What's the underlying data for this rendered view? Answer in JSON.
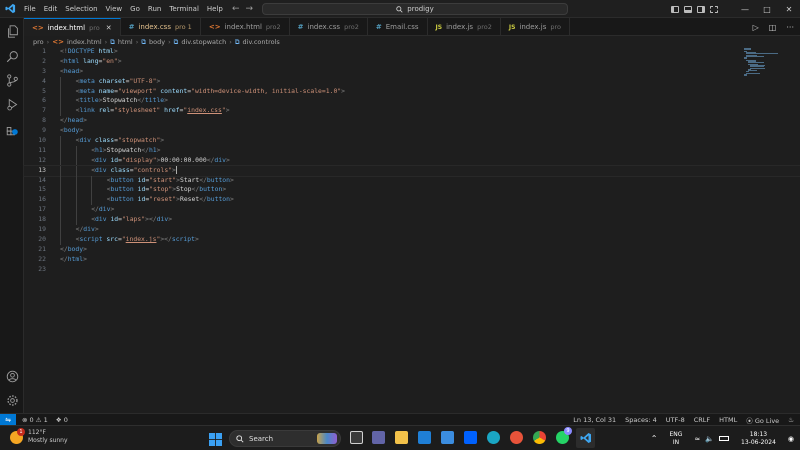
{
  "titlebar": {
    "menu": [
      "File",
      "Edit",
      "Selection",
      "View",
      "Go",
      "Run",
      "Terminal",
      "Help"
    ],
    "search_text": "prodigy"
  },
  "tabs": [
    {
      "icon": "html",
      "icon_text": "<>",
      "name": "index.html",
      "hint": "pro",
      "active": true,
      "modified": false
    },
    {
      "icon": "css",
      "icon_text": "#",
      "name": "index.css",
      "hint": "pro 1",
      "active": false,
      "modified": true
    },
    {
      "icon": "html",
      "icon_text": "<>",
      "name": "index.html",
      "hint": "pro2",
      "active": false,
      "modified": false
    },
    {
      "icon": "css",
      "icon_text": "#",
      "name": "index.css",
      "hint": "pro2",
      "active": false,
      "modified": false
    },
    {
      "icon": "css",
      "icon_text": "#",
      "name": "Email.css",
      "hint": "",
      "active": false,
      "modified": false
    },
    {
      "icon": "js",
      "icon_text": "JS",
      "name": "index.js",
      "hint": "pro2",
      "active": false,
      "modified": false
    },
    {
      "icon": "js",
      "icon_text": "JS",
      "name": "index.js",
      "hint": "pro",
      "active": false,
      "modified": false
    }
  ],
  "breadcrumb": [
    "pro",
    "index.html",
    "html",
    "body",
    "div.stopwatch",
    "div.controls"
  ],
  "code_lines": [
    {
      "n": "1",
      "indent": 0,
      "tokens": [
        [
          "br",
          "<!"
        ],
        [
          "tag",
          "DOCTYPE"
        ],
        [
          "text",
          " "
        ],
        [
          "attr",
          "html"
        ],
        [
          "br",
          ">"
        ]
      ]
    },
    {
      "n": "2",
      "indent": 0,
      "tokens": [
        [
          "br",
          "<"
        ],
        [
          "tag",
          "html"
        ],
        [
          "text",
          " "
        ],
        [
          "attr",
          "lang"
        ],
        [
          "text",
          "="
        ],
        [
          "str",
          "\"en\""
        ],
        [
          "br",
          ">"
        ]
      ]
    },
    {
      "n": "3",
      "indent": 0,
      "tokens": [
        [
          "br",
          "<"
        ],
        [
          "tag",
          "head"
        ],
        [
          "br",
          ">"
        ]
      ]
    },
    {
      "n": "4",
      "indent": 1,
      "tokens": [
        [
          "br",
          "<"
        ],
        [
          "tag",
          "meta"
        ],
        [
          "text",
          " "
        ],
        [
          "attr",
          "charset"
        ],
        [
          "text",
          "="
        ],
        [
          "str",
          "\"UTF-8\""
        ],
        [
          "br",
          ">"
        ]
      ]
    },
    {
      "n": "5",
      "indent": 1,
      "tokens": [
        [
          "br",
          "<"
        ],
        [
          "tag",
          "meta"
        ],
        [
          "text",
          " "
        ],
        [
          "attr",
          "name"
        ],
        [
          "text",
          "="
        ],
        [
          "str",
          "\"viewport\""
        ],
        [
          "text",
          " "
        ],
        [
          "attr",
          "content"
        ],
        [
          "text",
          "="
        ],
        [
          "str",
          "\"width=device-width, initial-scale=1.0\""
        ],
        [
          "br",
          ">"
        ]
      ]
    },
    {
      "n": "6",
      "indent": 1,
      "tokens": [
        [
          "br",
          "<"
        ],
        [
          "tag",
          "title"
        ],
        [
          "br",
          ">"
        ],
        [
          "text",
          "Stopwatch"
        ],
        [
          "br",
          "</"
        ],
        [
          "tag",
          "title"
        ],
        [
          "br",
          ">"
        ]
      ]
    },
    {
      "n": "7",
      "indent": 1,
      "tokens": [
        [
          "br",
          "<"
        ],
        [
          "tag",
          "link"
        ],
        [
          "text",
          " "
        ],
        [
          "attr",
          "rel"
        ],
        [
          "text",
          "="
        ],
        [
          "str",
          "\"stylesheet\""
        ],
        [
          "text",
          " "
        ],
        [
          "attr",
          "href"
        ],
        [
          "text",
          "="
        ],
        [
          "str",
          "\""
        ],
        [
          "link",
          "index.css"
        ],
        [
          "str",
          "\""
        ],
        [
          "br",
          ">"
        ]
      ]
    },
    {
      "n": "8",
      "indent": 0,
      "tokens": [
        [
          "br",
          "</"
        ],
        [
          "tag",
          "head"
        ],
        [
          "br",
          ">"
        ]
      ]
    },
    {
      "n": "9",
      "indent": 0,
      "tokens": [
        [
          "br",
          "<"
        ],
        [
          "tag",
          "body"
        ],
        [
          "br",
          ">"
        ]
      ]
    },
    {
      "n": "10",
      "indent": 1,
      "tokens": [
        [
          "br",
          "<"
        ],
        [
          "tag",
          "div"
        ],
        [
          "text",
          " "
        ],
        [
          "attr",
          "class"
        ],
        [
          "text",
          "="
        ],
        [
          "str",
          "\"stopwatch\""
        ],
        [
          "br",
          ">"
        ]
      ]
    },
    {
      "n": "11",
      "indent": 2,
      "tokens": [
        [
          "br",
          "<"
        ],
        [
          "tag",
          "h1"
        ],
        [
          "br",
          ">"
        ],
        [
          "text",
          "Stopwatch"
        ],
        [
          "br",
          "</"
        ],
        [
          "tag",
          "h1"
        ],
        [
          "br",
          ">"
        ]
      ]
    },
    {
      "n": "12",
      "indent": 2,
      "tokens": [
        [
          "br",
          "<"
        ],
        [
          "tag",
          "div"
        ],
        [
          "text",
          " "
        ],
        [
          "attr",
          "id"
        ],
        [
          "text",
          "="
        ],
        [
          "str",
          "\"display\""
        ],
        [
          "br",
          ">"
        ],
        [
          "text",
          "00:00:00.000"
        ],
        [
          "br",
          "</"
        ],
        [
          "tag",
          "div"
        ],
        [
          "br",
          ">"
        ]
      ]
    },
    {
      "n": "13",
      "indent": 2,
      "current": true,
      "tokens": [
        [
          "br",
          "<"
        ],
        [
          "tag",
          "div"
        ],
        [
          "text",
          " "
        ],
        [
          "attr",
          "class"
        ],
        [
          "text",
          "="
        ],
        [
          "str",
          "\"controls\""
        ],
        [
          "br",
          ">"
        ]
      ]
    },
    {
      "n": "14",
      "indent": 3,
      "tokens": [
        [
          "br",
          "<"
        ],
        [
          "tag",
          "button"
        ],
        [
          "text",
          " "
        ],
        [
          "attr",
          "id"
        ],
        [
          "text",
          "="
        ],
        [
          "str",
          "\"start\""
        ],
        [
          "br",
          ">"
        ],
        [
          "text",
          "Start"
        ],
        [
          "br",
          "</"
        ],
        [
          "tag",
          "button"
        ],
        [
          "br",
          ">"
        ]
      ]
    },
    {
      "n": "15",
      "indent": 3,
      "tokens": [
        [
          "br",
          "<"
        ],
        [
          "tag",
          "button"
        ],
        [
          "text",
          " "
        ],
        [
          "attr",
          "id"
        ],
        [
          "text",
          "="
        ],
        [
          "str",
          "\"stop\""
        ],
        [
          "br",
          ">"
        ],
        [
          "text",
          "Stop"
        ],
        [
          "br",
          "</"
        ],
        [
          "tag",
          "button"
        ],
        [
          "br",
          ">"
        ]
      ]
    },
    {
      "n": "16",
      "indent": 3,
      "tokens": [
        [
          "br",
          "<"
        ],
        [
          "tag",
          "button"
        ],
        [
          "text",
          " "
        ],
        [
          "attr",
          "id"
        ],
        [
          "text",
          "="
        ],
        [
          "str",
          "\"reset\""
        ],
        [
          "br",
          ">"
        ],
        [
          "text",
          "Reset"
        ],
        [
          "br",
          "</"
        ],
        [
          "tag",
          "button"
        ],
        [
          "br",
          ">"
        ]
      ]
    },
    {
      "n": "17",
      "indent": 2,
      "tokens": [
        [
          "br",
          "</"
        ],
        [
          "tag",
          "div"
        ],
        [
          "br",
          ">"
        ]
      ]
    },
    {
      "n": "18",
      "indent": 2,
      "tokens": [
        [
          "br",
          "<"
        ],
        [
          "tag",
          "div"
        ],
        [
          "text",
          " "
        ],
        [
          "attr",
          "id"
        ],
        [
          "text",
          "="
        ],
        [
          "str",
          "\"laps\""
        ],
        [
          "br",
          "></"
        ],
        [
          "tag",
          "div"
        ],
        [
          "br",
          ">"
        ]
      ]
    },
    {
      "n": "19",
      "indent": 1,
      "tokens": [
        [
          "br",
          "</"
        ],
        [
          "tag",
          "div"
        ],
        [
          "br",
          ">"
        ]
      ]
    },
    {
      "n": "20",
      "indent": 1,
      "tokens": [
        [
          "br",
          "<"
        ],
        [
          "tag",
          "script"
        ],
        [
          "text",
          " "
        ],
        [
          "attr",
          "src"
        ],
        [
          "text",
          "="
        ],
        [
          "str",
          "\""
        ],
        [
          "link",
          "index.js"
        ],
        [
          "str",
          "\""
        ],
        [
          "br",
          "></"
        ],
        [
          "tag",
          "script"
        ],
        [
          "br",
          ">"
        ]
      ]
    },
    {
      "n": "21",
      "indent": 0,
      "tokens": [
        [
          "br",
          "</"
        ],
        [
          "tag",
          "body"
        ],
        [
          "br",
          ">"
        ]
      ]
    },
    {
      "n": "22",
      "indent": 0,
      "tokens": [
        [
          "br",
          "</"
        ],
        [
          "tag",
          "html"
        ],
        [
          "br",
          ">"
        ]
      ]
    },
    {
      "n": "23",
      "indent": 0,
      "tokens": []
    }
  ],
  "statusbar": {
    "errors": "0",
    "warnings": "1",
    "ports": "0",
    "position": "Ln 13, Col 31",
    "spaces": "Spaces: 4",
    "encoding": "UTF-8",
    "eol": "CRLF",
    "language": "HTML",
    "live": "Go Live"
  },
  "taskbar": {
    "weather_temp": "112°F",
    "weather_desc": "Mostly sunny",
    "weather_badge": "1",
    "search_label": "Search",
    "lang_line1": "ENG",
    "lang_line2": "IN",
    "time": "18:13",
    "date": "13-06-2024",
    "whatsapp_badge": "9"
  },
  "colors": {
    "accent": "#0078d4",
    "editor_bg": "#1e1e1e",
    "modified_tab": "#e2c08d"
  }
}
